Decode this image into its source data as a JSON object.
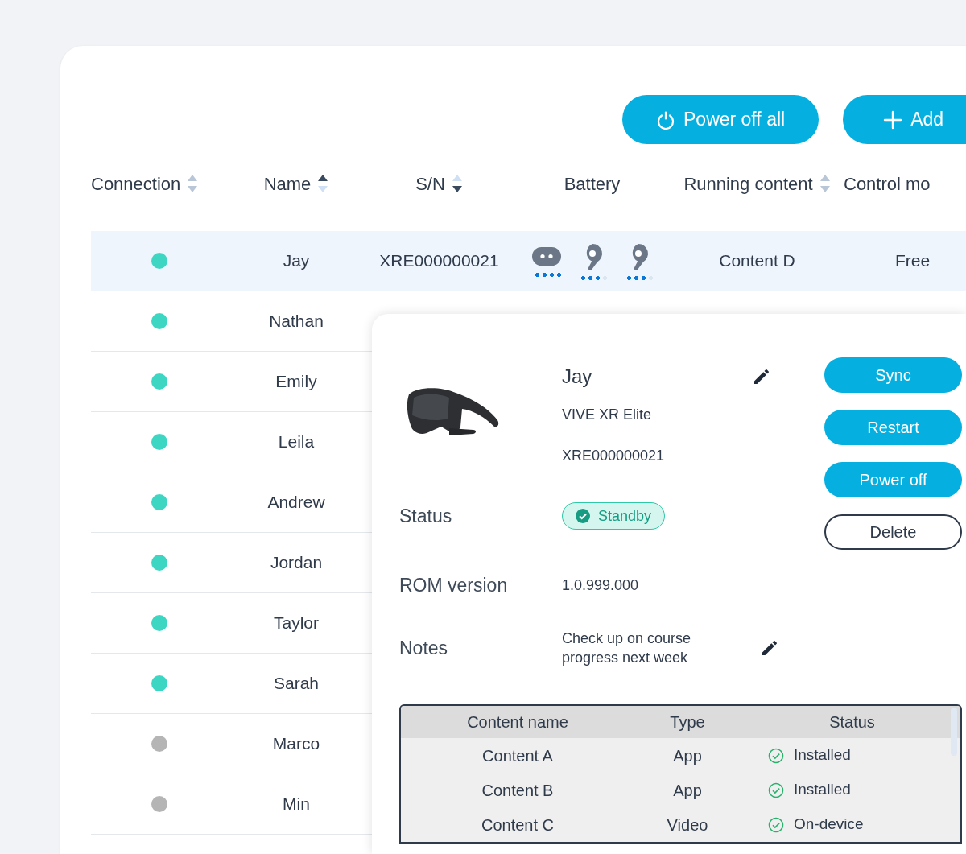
{
  "toolbar": {
    "buttons": [
      {
        "label": "Power off all",
        "kind": "power"
      },
      {
        "label": "Add",
        "kind": "add"
      }
    ]
  },
  "table": {
    "columns": [
      {
        "label": "Connection",
        "sortable": true,
        "sorted_ascending": false,
        "sorted_descending": false
      },
      {
        "label": "Name",
        "sortable": true,
        "sorted_ascending": true,
        "sorted_descending": false
      },
      {
        "label": "S/N",
        "sortable": true,
        "sorted_ascending": false,
        "sorted_descending": true
      },
      {
        "label": "Battery"
      },
      {
        "label": "Running content",
        "sortable": true,
        "sorted_ascending": false,
        "sorted_descending": false
      },
      {
        "label": "Control mo"
      }
    ],
    "rows": [
      {
        "connected": true,
        "selected": true,
        "name": "Jay",
        "sn": "XRE000000021",
        "battery": [
          {
            "kind": "headset",
            "level": 1
          },
          {
            "kind": "controller",
            "level": 0.75
          },
          {
            "kind": "controller",
            "level": 0.75
          }
        ],
        "running_content": "Content D",
        "control_mode": "Free"
      },
      {
        "connected": true,
        "selected": false,
        "name": "Nathan"
      },
      {
        "connected": true,
        "selected": false,
        "name": "Emily"
      },
      {
        "connected": true,
        "selected": false,
        "name": "Leila"
      },
      {
        "connected": true,
        "selected": false,
        "name": "Andrew"
      },
      {
        "connected": true,
        "selected": false,
        "name": "Jordan"
      },
      {
        "connected": true,
        "selected": false,
        "name": "Taylor"
      },
      {
        "connected": true,
        "selected": false,
        "name": "Sarah"
      },
      {
        "connected": false,
        "selected": false,
        "name": "Marco"
      },
      {
        "connected": false,
        "selected": false,
        "name": "Min"
      }
    ]
  },
  "device_panel": {
    "name": "Jay",
    "model": "VIVE XR Elite",
    "serial": "XRE000000021",
    "status_label": "Status",
    "status": "Standby",
    "rom_label": "ROM version",
    "rom": "1.0.999.000",
    "notes_label": "Notes",
    "notes": "Check up on course progress next week",
    "actions": [
      {
        "label": "Sync",
        "kind": "primary"
      },
      {
        "label": "Restart",
        "kind": "primary"
      },
      {
        "label": "Power off",
        "kind": "primary"
      },
      {
        "label": "Delete",
        "kind": "outline"
      }
    ],
    "contents": {
      "columns": [
        "Content name",
        "Type",
        "Status"
      ],
      "rows": [
        {
          "name": "Content A",
          "type": "App",
          "status": "Installed"
        },
        {
          "name": "Content B",
          "type": "App",
          "status": "Installed"
        },
        {
          "name": "Content C",
          "type": "Video",
          "status": "On-device"
        }
      ]
    }
  }
}
